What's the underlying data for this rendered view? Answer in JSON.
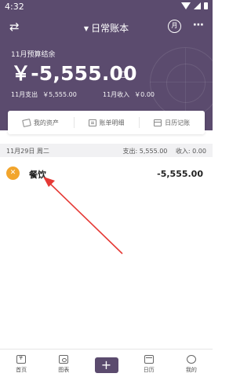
{
  "status": {
    "time": "4:32"
  },
  "header": {
    "book_title": "日常账本",
    "month_icon_text": "月",
    "more_text": "⋯"
  },
  "budget": {
    "label": "11月预算结余",
    "amount": "￥-5,555.00",
    "expense_label": "11月支出",
    "expense_value": "￥5,555.00",
    "income_label": "11月收入",
    "income_value": "￥0.00"
  },
  "tabs": [
    {
      "label": "我的资产",
      "icon": "wallet-icon"
    },
    {
      "label": "账单明细",
      "icon": "list-icon"
    },
    {
      "label": "日历记账",
      "icon": "calendar-icon"
    }
  ],
  "day": {
    "date": "11月29日 周二",
    "expense": "支出: 5,555.00",
    "income": "收入: 0.00"
  },
  "entry": {
    "category": "餐饮",
    "amount": "-5,555.00",
    "icon": "fork-knife-icon",
    "icon_color": "#f2a52c"
  },
  "nav": [
    {
      "label": "首页",
      "icon": "home-icon"
    },
    {
      "label": "图表",
      "icon": "chart-icon"
    },
    {
      "label": "",
      "icon": "add-icon",
      "symbol": "+"
    },
    {
      "label": "日历",
      "icon": "calendar-icon"
    },
    {
      "label": "我的",
      "icon": "profile-icon"
    }
  ],
  "colors": {
    "primary": "#5b4b6e",
    "accent": "#f2a52c",
    "annotation_arrow": "#e53935"
  }
}
